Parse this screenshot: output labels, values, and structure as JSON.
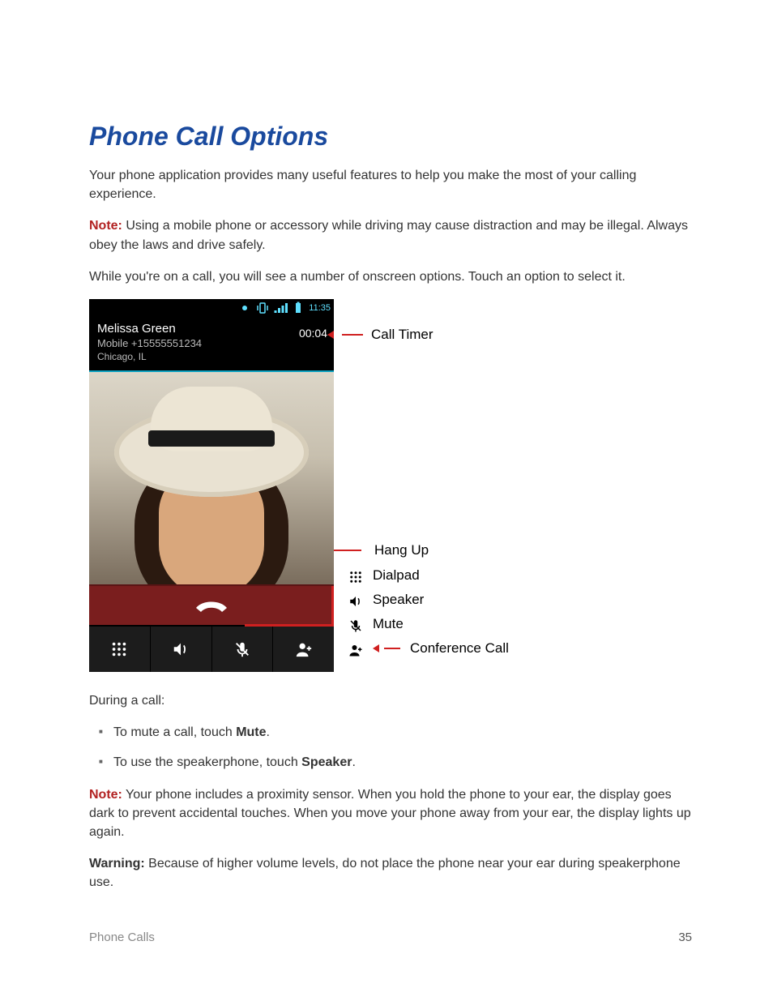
{
  "title": "Phone Call Options",
  "intro": "Your phone application provides many useful features to help you make the most of your calling experience.",
  "note1_label": "Note:",
  "note1_text": " Using a mobile phone or accessory while driving may cause distraction and may be illegal. Always obey the laws and drive safely.",
  "para2": "While you're on a call, you will see a number of onscreen options. Touch an option to select it.",
  "phone": {
    "status_time": "11:35",
    "caller_name": "Melissa Green",
    "caller_number": "Mobile +15555551234",
    "caller_location": "Chicago, IL",
    "call_timer": "00:04"
  },
  "callouts": {
    "timer": "Call Timer",
    "hangup": "Hang Up",
    "dialpad": "Dialpad",
    "speaker": "Speaker",
    "mute": "Mute",
    "conference": "Conference Call"
  },
  "during_label": "During a call:",
  "bullets": {
    "b1_pre": "To mute a call, touch ",
    "b1_bold": "Mute",
    "b1_post": ".",
    "b2_pre": "To use the speakerphone, touch ",
    "b2_bold": "Speaker",
    "b2_post": "."
  },
  "note2_label": "Note:",
  "note2_text": " Your phone includes a proximity sensor. When you hold the phone to your ear, the display goes dark to prevent accidental touches. When you move your phone away from your ear, the display lights up again.",
  "warning_label": "Warning:",
  "warning_text": " Because of higher volume levels, do not place the phone near your ear during speakerphone use.",
  "footer_section": "Phone Calls",
  "footer_page": "35"
}
